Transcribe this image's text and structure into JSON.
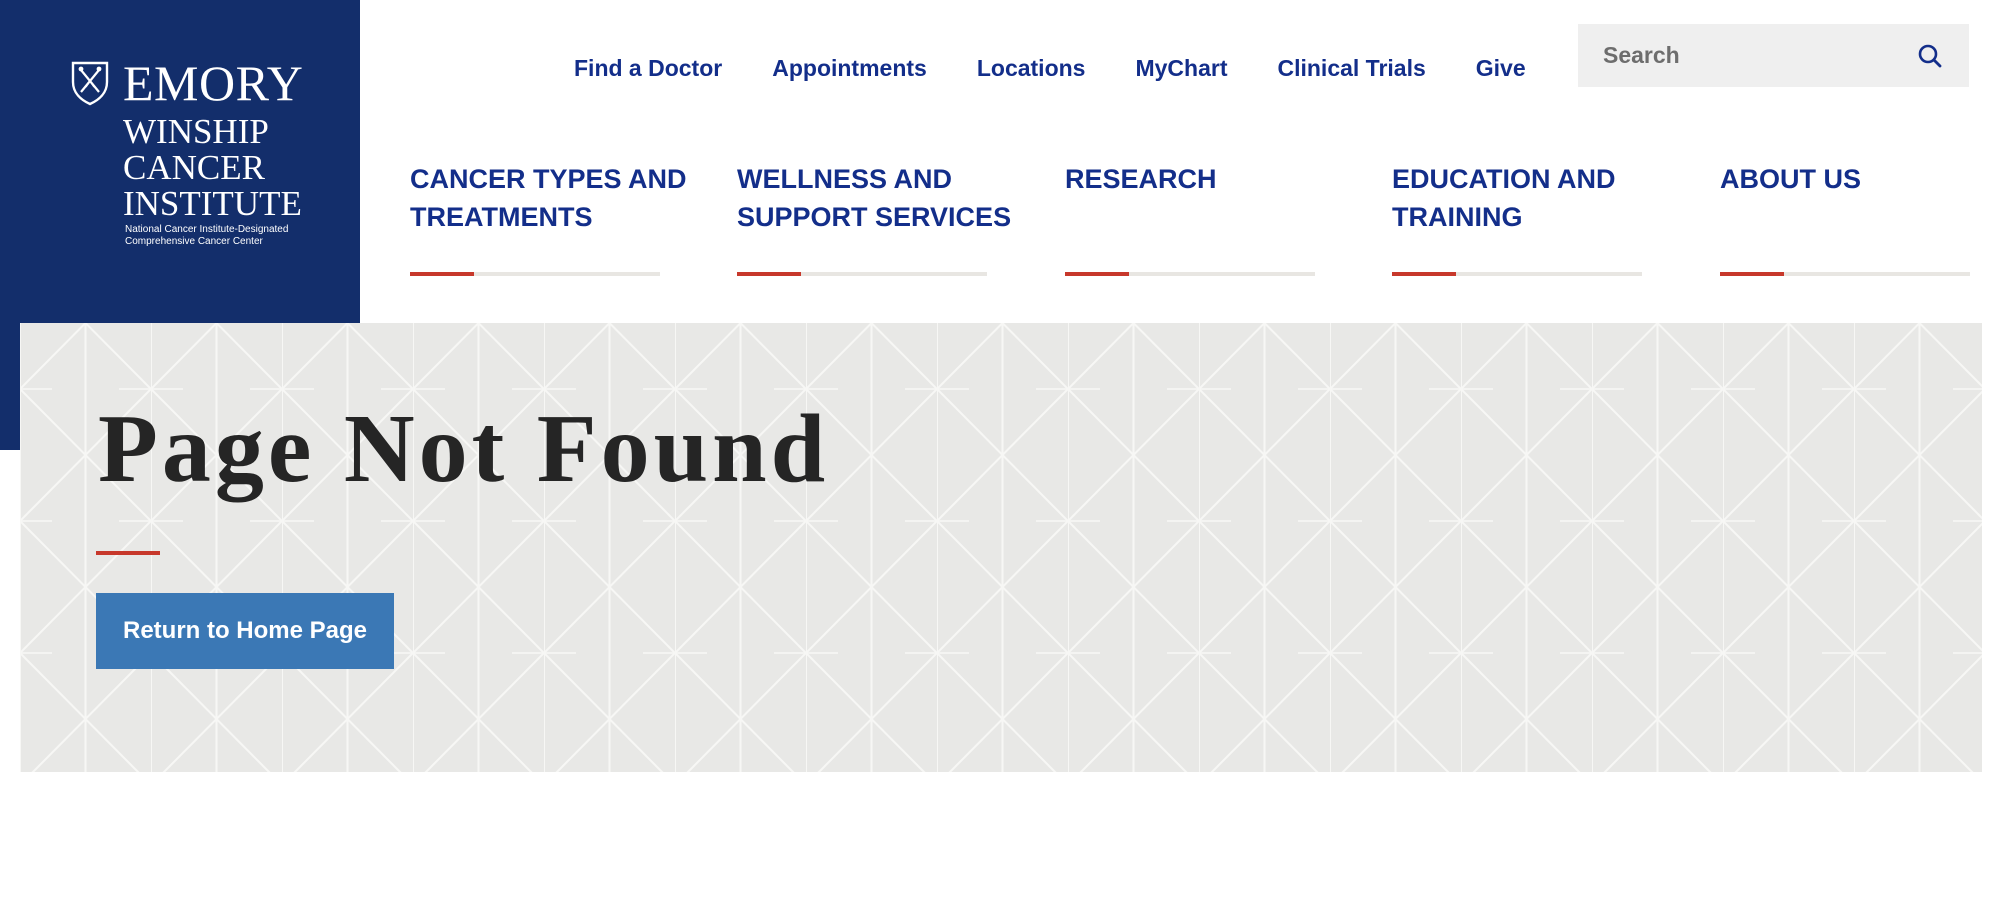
{
  "logo": {
    "line1": "EMORY",
    "line2": "WINSHIP",
    "line3": "CANCER",
    "line4": "INSTITUTE",
    "tagline1": "National Cancer Institute-Designated",
    "tagline2": "Comprehensive Cancer Center",
    "icon": "emory-shield-icon"
  },
  "utility_nav": [
    "Find a Doctor",
    "Appointments",
    "Locations",
    "MyChart",
    "Clinical Trials",
    "Give"
  ],
  "search": {
    "placeholder": "Search",
    "icon": "search-icon"
  },
  "main_nav": [
    {
      "line1": "CANCER TYPES AND",
      "line2": "TREATMENTS"
    },
    {
      "line1": "WELLNESS AND",
      "line2": "SUPPORT SERVICES"
    },
    {
      "line1": "RESEARCH",
      "line2": ""
    },
    {
      "line1": "EDUCATION AND",
      "line2": "TRAINING"
    },
    {
      "line1": "ABOUT US",
      "line2": ""
    }
  ],
  "hero": {
    "title": "Page Not Found",
    "button_label": "Return to Home Page"
  },
  "colors": {
    "brand_navy": "#132e6b",
    "link_blue": "#132e8a",
    "accent_red": "#c7382b",
    "button_blue": "#3b78b5",
    "hero_gray": "#e8e8e6"
  }
}
